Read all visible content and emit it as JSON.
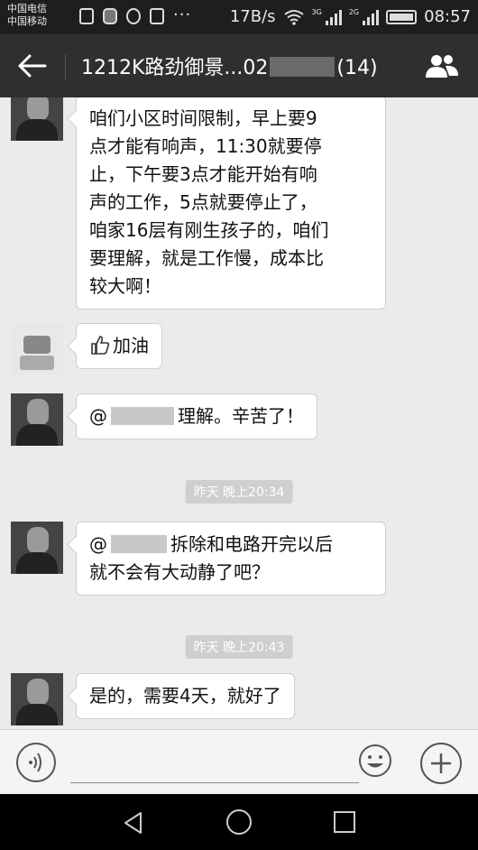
{
  "status_bar": {
    "carrier_1": "中国电信",
    "carrier_2": "中国移动",
    "net_speed": "17B/s",
    "net_badges": [
      "3G",
      "2G",
      "2G"
    ],
    "time": "08:57"
  },
  "header": {
    "title_prefix": "1212K路劲御景...02",
    "title_suffix": "(14)"
  },
  "messages": [
    {
      "text": "咱们小区时间限制，早上要9\n点才能有响声，11:30就要停\n止，下午要3点才能开始有响\n声的工作，5点就要停止了，\n咱家16层有刚生孩子的，咱们\n要理解，就是工作慢，成本比\n较大啊！"
    },
    {
      "text": "加油"
    },
    {
      "prefix": "@",
      "text": "理解。辛苦了！"
    },
    {
      "prefix": "@",
      "text": "拆除和电路开完以后\n就不会有大动静了吧？"
    },
    {
      "text": "是的，需要4天，就好了"
    }
  ],
  "timestamps": [
    "昨天 晚上20:34",
    "昨天 晚上20:43"
  ],
  "input": {
    "placeholder": ""
  },
  "colors": {
    "header_bg": "#2f2f2f",
    "chat_bg": "#ebebeb",
    "bubble_bg": "#ffffff"
  }
}
